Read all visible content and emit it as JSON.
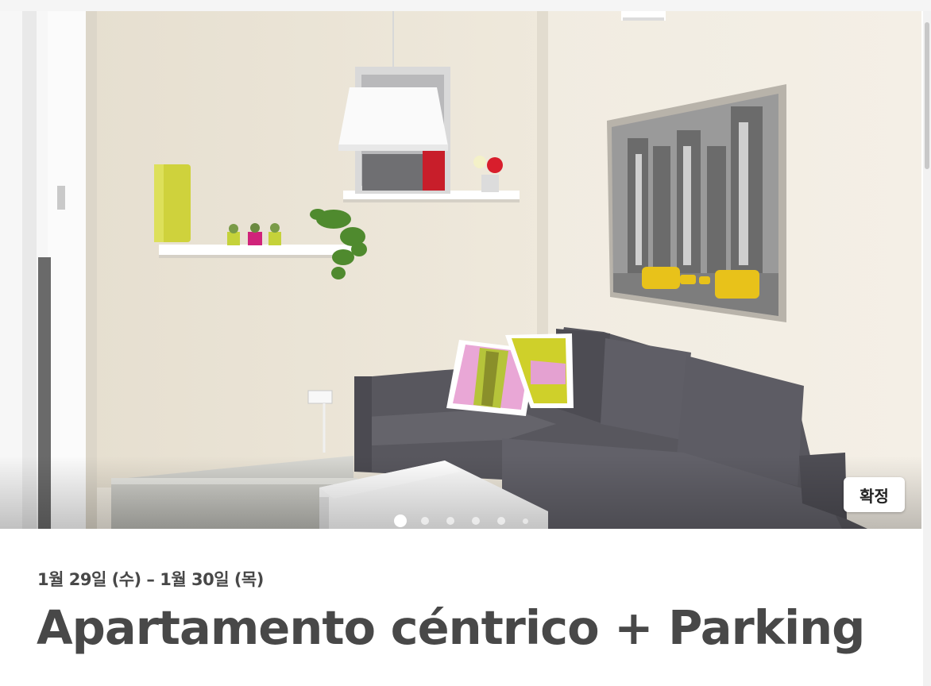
{
  "listing": {
    "dates": "1월 29일 (수) – 1월 30일 (목)",
    "title": "Apartamento céntrico + Parking",
    "status_badge": "확정"
  },
  "carousel": {
    "image_description": "living-room-photo",
    "dot_count": 6,
    "active_index": 0
  },
  "colors": {
    "text": "#484848",
    "badge_bg": "#ffffff",
    "wall": "#ece6d8",
    "sofa": "#58575e"
  }
}
